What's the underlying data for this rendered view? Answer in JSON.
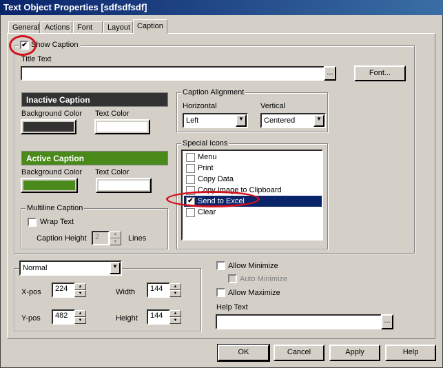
{
  "window": {
    "title": "Text Object Properties [sdfsdfsdf]"
  },
  "tabs": [
    {
      "label": "General"
    },
    {
      "label": "Actions"
    },
    {
      "label": "Font"
    },
    {
      "label": "Layout"
    },
    {
      "label": "Caption"
    }
  ],
  "show_caption": {
    "label": "Show Caption",
    "checked": true
  },
  "title_text": {
    "label": "Title Text",
    "value": "",
    "browse": "...",
    "font_button": "Font..."
  },
  "inactive_caption": {
    "label": "Inactive Caption",
    "bg_label": "Background Color",
    "text_label": "Text Color",
    "bg_color": "#333333",
    "text_color": "#ffffff"
  },
  "active_caption": {
    "label": "Active Caption",
    "bg_label": "Background Color",
    "text_label": "Text Color",
    "bg_color": "#4a8a1a",
    "text_color": "#ffffff"
  },
  "multiline": {
    "label": "Multiline Caption",
    "wrap_label": "Wrap Text",
    "wrap_checked": false,
    "height_label": "Caption Height",
    "height_value": "2",
    "lines_label": "Lines"
  },
  "alignment": {
    "label": "Caption Alignment",
    "horizontal_label": "Horizontal",
    "horizontal_value": "Left",
    "vertical_label": "Vertical",
    "vertical_value": "Centered"
  },
  "special_icons": {
    "label": "Special Icons",
    "items": [
      {
        "label": "Menu",
        "checked": false
      },
      {
        "label": "Print",
        "checked": false
      },
      {
        "label": "Copy Data",
        "checked": false
      },
      {
        "label": "Copy Image to Clipboard",
        "checked": false
      },
      {
        "label": "Send to Excel",
        "checked": true
      },
      {
        "label": "Clear",
        "checked": false
      }
    ]
  },
  "position": {
    "mode": "Normal",
    "xpos_label": "X-pos",
    "xpos": "224",
    "ypos_label": "Y-pos",
    "ypos": "482",
    "width_label": "Width",
    "width": "144",
    "height_label": "Height",
    "height": "144"
  },
  "options": {
    "allow_minimize": "Allow Minimize",
    "auto_minimize": "Auto Minimize",
    "allow_maximize": "Allow Maximize",
    "help_text_label": "Help Text",
    "help_text": "",
    "browse": "..."
  },
  "buttons": {
    "ok": "OK",
    "cancel": "Cancel",
    "apply": "Apply",
    "help": "Help"
  },
  "check": "✔",
  "arrow_down": "▼",
  "arrow_up": "▲"
}
